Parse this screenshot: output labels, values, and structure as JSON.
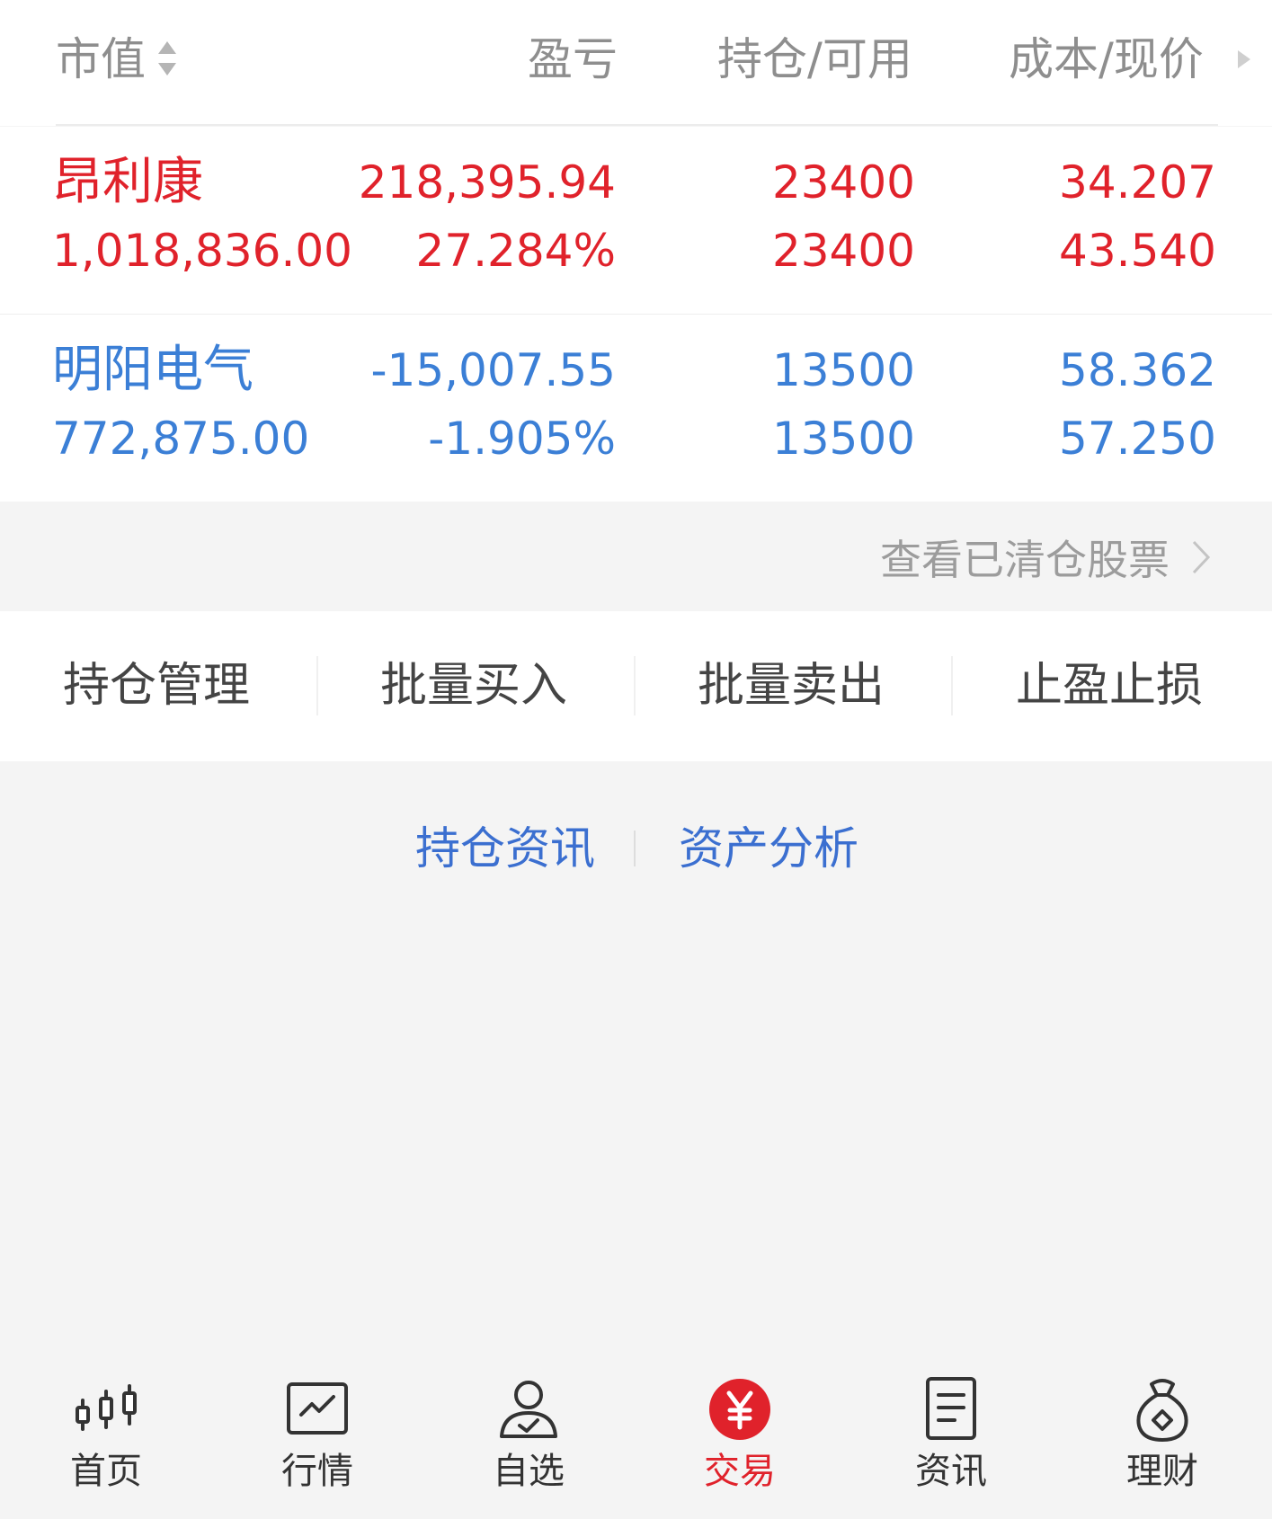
{
  "table_header": {
    "market_value": "市值",
    "pnl": "盈亏",
    "position_available": "持仓/可用",
    "cost_price": "成本/现价"
  },
  "holdings": [
    {
      "name": "昂利康",
      "market_value": "1,018,836.00",
      "pnl": "218,395.94",
      "pnl_pct": "27.284%",
      "position": "23400",
      "available": "23400",
      "cost": "34.207",
      "price": "43.540",
      "trend": "up"
    },
    {
      "name": "明阳电气",
      "market_value": "772,875.00",
      "pnl": "-15,007.55",
      "pnl_pct": "-1.905%",
      "position": "13500",
      "available": "13500",
      "cost": "58.362",
      "price": "57.250",
      "trend": "down"
    }
  ],
  "cleared_link": "查看已清仓股票",
  "actions": [
    "持仓管理",
    "批量买入",
    "批量卖出",
    "止盈止损"
  ],
  "info_links": [
    "持仓资讯",
    "资产分析"
  ],
  "bottom_nav": [
    {
      "label": "首页",
      "icon": "candlestick-icon",
      "active": false
    },
    {
      "label": "行情",
      "icon": "chart-line-icon",
      "active": false
    },
    {
      "label": "自选",
      "icon": "user-check-icon",
      "active": false
    },
    {
      "label": "交易",
      "icon": "yuan-icon",
      "active": true
    },
    {
      "label": "资讯",
      "icon": "document-icon",
      "active": false
    },
    {
      "label": "理财",
      "icon": "money-bag-icon",
      "active": false
    }
  ],
  "colors": {
    "up": "#e0222b",
    "down": "#3b7fd6",
    "link": "#3b6fd0",
    "muted": "#8e8e8e"
  }
}
